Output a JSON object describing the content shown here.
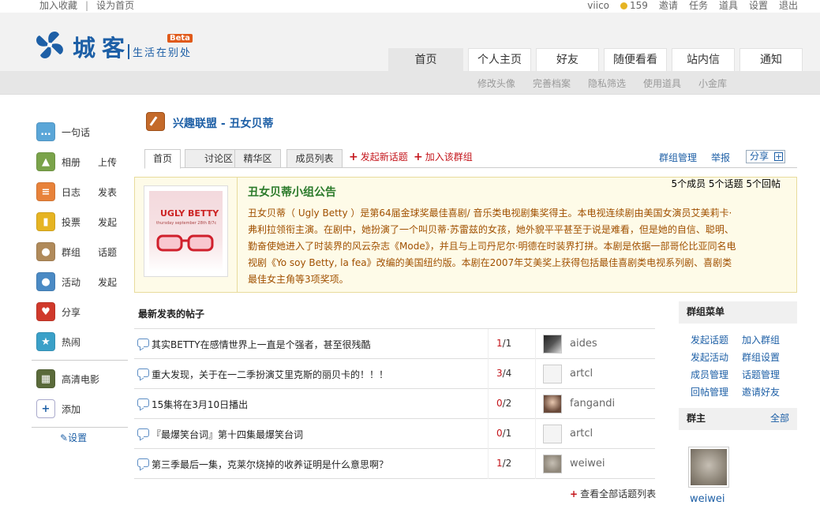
{
  "topbar": {
    "bookmark": "加入收藏",
    "homepage": "设为首页",
    "username": "viico",
    "coins": "159",
    "invite": "邀请",
    "tasks": "任务",
    "tools": "道具",
    "settings": "设置",
    "logout": "退出"
  },
  "logo": {
    "brand": "城客",
    "slogan": "生活在别处",
    "beta": "Beta",
    "color": "#1d5fa6"
  },
  "mainnav": [
    "首页",
    "个人主页",
    "好友",
    "随便看看",
    "站内信",
    "通知"
  ],
  "subnav": [
    "修改头像",
    "完善档案",
    "隐私筛选",
    "使用道具",
    "小金库"
  ],
  "sidebar": {
    "items": [
      {
        "label": "一句话",
        "action": "",
        "icon": "chat-icon"
      },
      {
        "label": "相册",
        "action": "上传",
        "icon": "photo-icon"
      },
      {
        "label": "日志",
        "action": "发表",
        "icon": "blog-icon"
      },
      {
        "label": "投票",
        "action": "发起",
        "icon": "poll-icon"
      },
      {
        "label": "群组",
        "action": "话题",
        "icon": "group-icon"
      },
      {
        "label": "活动",
        "action": "发起",
        "icon": "event-icon"
      },
      {
        "label": "分享",
        "action": "",
        "icon": "heart-icon"
      },
      {
        "label": "热闹",
        "action": "",
        "icon": "fun-icon"
      }
    ],
    "extra": [
      {
        "label": "高清电影",
        "icon": "film-icon"
      },
      {
        "label": "添加",
        "icon": "add-icon"
      }
    ],
    "setting": "设置"
  },
  "group": {
    "category": "兴趣联盟",
    "separator": " - ",
    "name": "丑女贝蒂"
  },
  "tabs": {
    "items": [
      "首页",
      "讨论区",
      "精华区",
      "成员列表"
    ],
    "new_topic": "发起新话题",
    "join": "加入该群组",
    "manage": "群组管理",
    "report": "举报",
    "share": "分享"
  },
  "notice": {
    "title": "丑女贝蒂小组公告",
    "stats": "5个成员  5个话题  5个回帖",
    "image_title": "UGLY BETTY",
    "image_sub": "thursday september 28th 8/7c",
    "text": "丑女贝蒂（ Ugly Betty ）是第64届金球奖最佳喜剧/ 音乐类电视剧集奖得主。本电视连续剧由美国女演员艾美莉卡·弗利拉领衔主演。在剧中，她扮演了一个叫贝蒂·苏雷兹的女孩，她外貌平平甚至于说是难看，但是她的自信、聪明、勤奋使她进入了时装界的风云杂志《Mode》，并且与上司丹尼尔·明德在时装界打拼。本剧是依据一部哥伦比亚同名电视剧《Yo soy Betty, la fea》改编的美国纽约版。本剧在2007年艾美奖上获得包括最佳喜剧类电视系列剧、喜剧类最佳女主角等3项奖项。"
  },
  "posts": {
    "heading": "最新发表的帖子",
    "rows": [
      {
        "title": "其实BETTY在感情世界上一直是个强者，甚至很残酷",
        "replies": "1",
        "views": "/1",
        "user": "aides"
      },
      {
        "title": "重大发现，关于在一二季扮演艾里克斯的丽贝卡的！！！",
        "replies": "3",
        "views": "/4",
        "user": "artcl"
      },
      {
        "title": "15集将在3月10日播出",
        "replies": "0",
        "views": "/2",
        "user": "fangandi"
      },
      {
        "title": "『最爆笑台词』第十四集最爆笑台词",
        "replies": "0",
        "views": "/1",
        "user": "artcl"
      },
      {
        "title": "第三季最后一集，克莱尔烧掉的收养证明是什么意思啊？",
        "replies": "1",
        "views": "/2",
        "user": "weiwei"
      }
    ],
    "view_all": "查看全部话题列表"
  },
  "group_menu": {
    "heading": "群组菜单",
    "items": [
      "发起话题",
      "加入群组",
      "发起活动",
      "群组设置",
      "成员管理",
      "话题管理",
      "回帖管理",
      "邀请好友"
    ]
  },
  "owner": {
    "heading": "群主",
    "all": "全部",
    "name": "weiwei"
  }
}
